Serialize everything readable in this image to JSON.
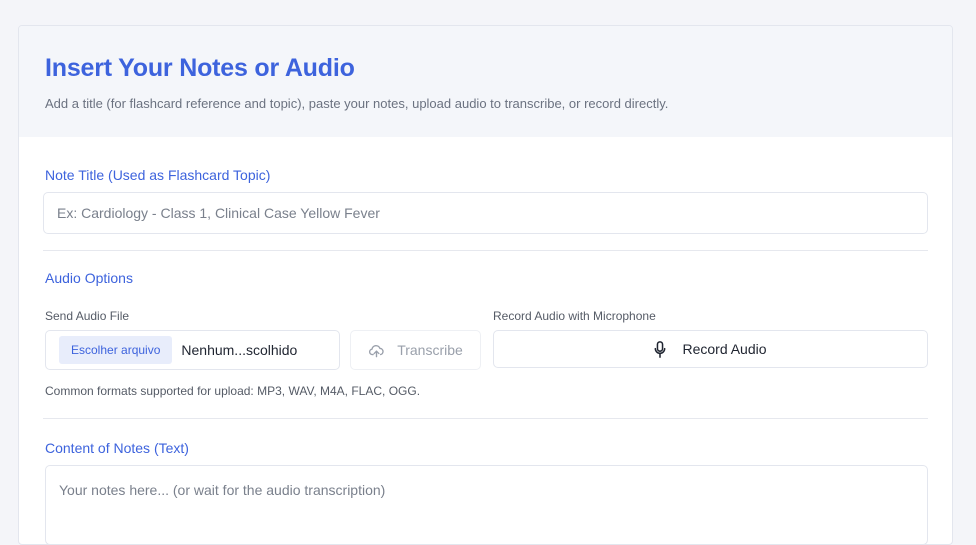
{
  "header": {
    "title": "Insert Your Notes or Audio",
    "subtitle": "Add a title (for flashcard reference and topic), paste your notes, upload audio to transcribe, or record directly."
  },
  "note_title": {
    "label": "Note Title (Used as Flashcard Topic)",
    "placeholder": "Ex: Cardiology - Class 1, Clinical Case Yellow Fever",
    "value": ""
  },
  "audio_options": {
    "label": "Audio Options",
    "send_file_label": "Send Audio File",
    "choose_file_button": "Escolher arquivo",
    "file_status": "Nenhum...scolhido",
    "transcribe_button": "Transcribe",
    "record_label": "Record Audio with Microphone",
    "record_button": "Record Audio",
    "formats_note": "Common formats supported for upload: MP3, WAV, M4A, FLAC, OGG."
  },
  "content": {
    "label": "Content of Notes (Text)",
    "placeholder": "Your notes here... (or wait for the audio transcription)",
    "value": ""
  },
  "icons": {
    "transcribe": "cloud-upload-icon",
    "record": "microphone-icon"
  },
  "colors": {
    "accent": "#3d63dd",
    "header_bg": "#f4f6fa",
    "file_button_bg": "#e8edfb"
  }
}
